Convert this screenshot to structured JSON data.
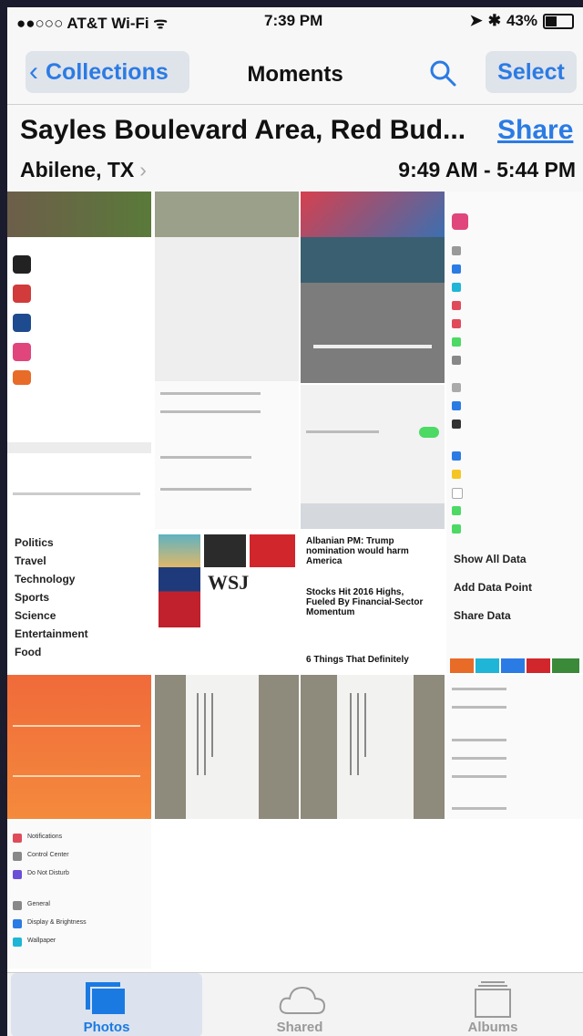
{
  "status_bar": {
    "carrier": "●●○○○ AT&T Wi-Fi ᯤ",
    "time": "7:39 PM",
    "bluetooth": "✱",
    "battery": "43%"
  },
  "nav": {
    "back_label": "Collections",
    "title": "Moments",
    "select_label": "Select"
  },
  "header": {
    "location": "Sayles Boulevard Area, Red Bud...",
    "share_label": "Share",
    "city": "Abilene, TX",
    "time_range": "9:49 AM - 5:44 PM"
  },
  "thumbnails": {
    "news_list": [
      "Politics",
      "Travel",
      "Technology",
      "Sports",
      "Science",
      "Entertainment",
      "Food"
    ],
    "settings_labels": [
      "Notifications",
      "Control Center",
      "Do Not Disturb",
      "General",
      "Display & Brightness",
      "Wallpaper"
    ],
    "health_actions": [
      "Show All Data",
      "Add Data Point",
      "Share Data"
    ],
    "news_headlines": [
      "Albanian PM: Trump nomination would harm America",
      "Stocks Hit 2016 Highs, Fueled By Financial-Sector Momentum",
      "6 Things That Definitely"
    ],
    "wsj_label": "WSJ"
  },
  "tabbar": {
    "photos": "Photos",
    "shared": "Shared",
    "albums": "Albums"
  },
  "colors": {
    "accent": "#2b7be4",
    "active_tab": "#1a7ae2",
    "inactive_tab": "#9a9a9a"
  }
}
